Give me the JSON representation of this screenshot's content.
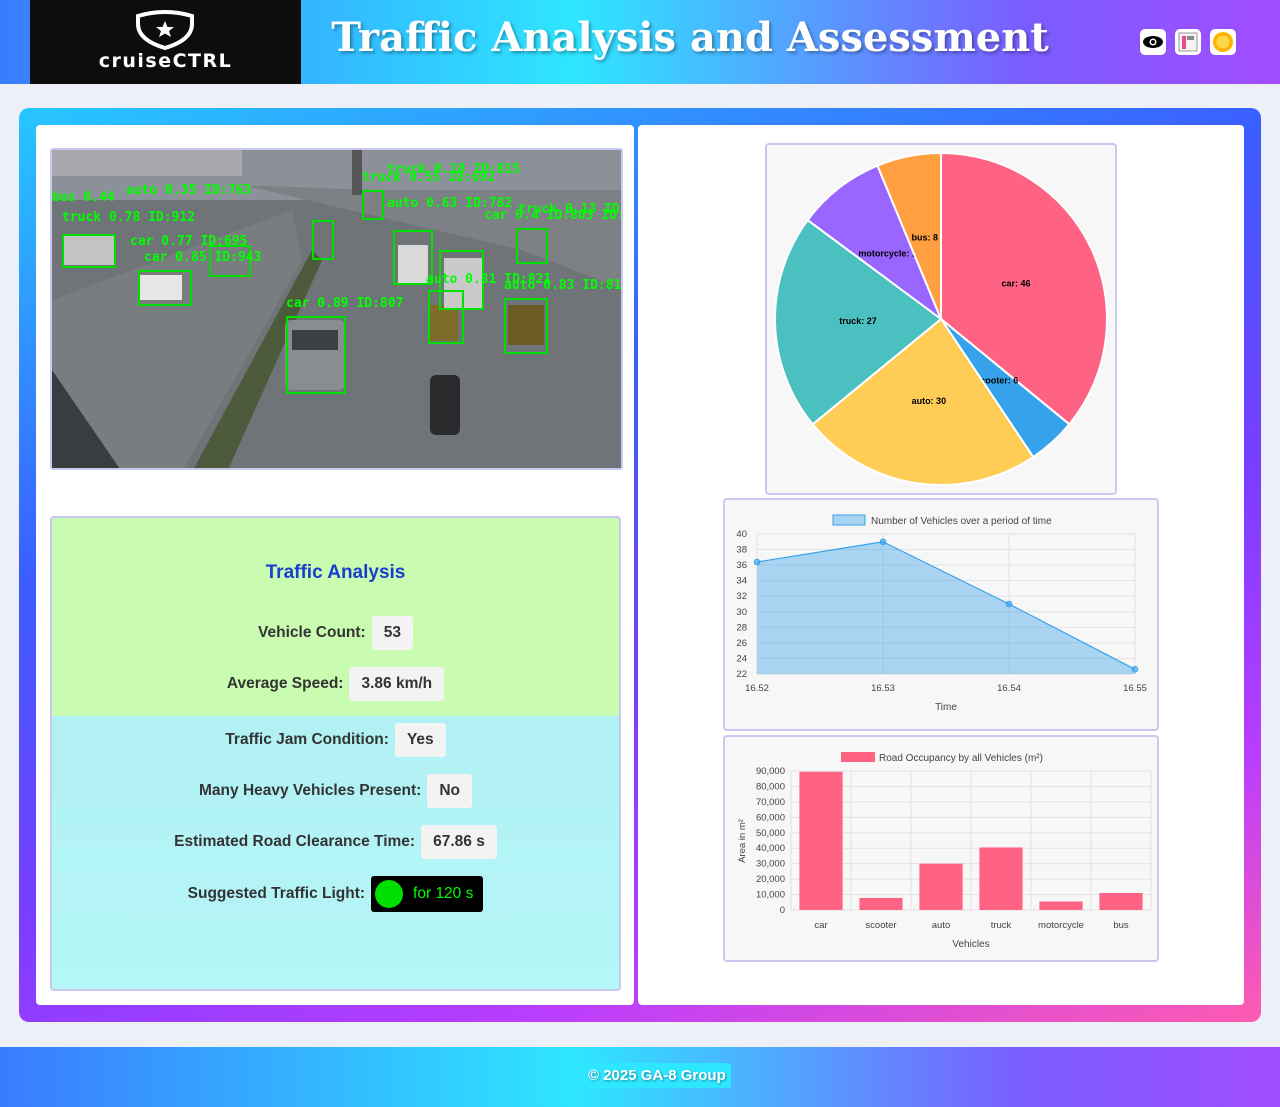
{
  "header": {
    "logo_text": "cruiseCTRL",
    "title": "Traffic Analysis and Assessment",
    "icons": [
      "eye-icon",
      "layout-icon",
      "sun-icon"
    ]
  },
  "video": {
    "detections": [
      {
        "label": "bus 0.44"
      },
      {
        "label": "auto 0.35 ID:763"
      },
      {
        "label": "truck 0.78 ID:912"
      },
      {
        "label": "car 0.77 ID:695"
      },
      {
        "label": "car 0.85 ID:943"
      },
      {
        "label": "truck 0.18 ID:815"
      },
      {
        "label": "truck 0.55 ID:692"
      },
      {
        "label": "auto 0.63 ID:782"
      },
      {
        "label": "car 0.4 ID:803 ID:2"
      },
      {
        "label": "truck 0.13 ID:1"
      },
      {
        "label": "auto 0.81 ID:821"
      },
      {
        "label": "auto 0.83 ID:815"
      },
      {
        "label": "car 0.89 ID:807"
      }
    ]
  },
  "analysis": {
    "title": "Traffic Analysis",
    "vehicle_count_label": "Vehicle Count:",
    "vehicle_count": "53",
    "avg_speed_label": "Average Speed:",
    "avg_speed": "3.86 km/h",
    "jam_label": "Traffic Jam Condition:",
    "jam": "Yes",
    "heavy_label": "Many Heavy Vehicles Present:",
    "heavy": "No",
    "clearance_label": "Estimated Road Clearance Time:",
    "clearance": "67.86 s",
    "light_label": "Suggested Traffic Light:",
    "light_text": "for 120 s",
    "light_color": "#00e000"
  },
  "charts": {
    "pie": {
      "type": "pie",
      "slices": [
        {
          "name": "car",
          "value": 46,
          "label": "car: 46",
          "color": "#ff6384"
        },
        {
          "name": "scooter",
          "value": 6,
          "label": "scooter: 6",
          "color": "#36a2eb"
        },
        {
          "name": "auto",
          "value": 30,
          "label": "auto: 30",
          "color": "#ffcd56"
        },
        {
          "name": "truck",
          "value": 27,
          "label": "truck: 27",
          "color": "#4bc0c0"
        },
        {
          "name": "motorcycle",
          "value": 11,
          "label": "motorcycle: 11",
          "color": "#9966ff"
        },
        {
          "name": "bus",
          "value": 8,
          "label": "bus: 8",
          "color": "#ff9f40"
        }
      ]
    },
    "line": {
      "type": "area",
      "legend": "Number of Vehicles over a period of time",
      "x": [
        "16.52",
        "16.53",
        "16.54",
        "16.55"
      ],
      "y": [
        36.4,
        39,
        31,
        22.6
      ],
      "ylim": [
        22,
        40
      ],
      "yticks": [
        "40",
        "38",
        "36",
        "34",
        "32",
        "30",
        "28",
        "26",
        "24",
        "22"
      ],
      "xlabel": "Time",
      "color": "#36a2eb"
    },
    "bar": {
      "type": "bar",
      "legend": "Road Occupancy by all Vehicles (m²)",
      "categories": [
        "car",
        "scooter",
        "auto",
        "truck",
        "motorcycle",
        "bus"
      ],
      "values": [
        89500,
        7800,
        30000,
        40500,
        5500,
        11000
      ],
      "ylim": [
        0,
        90000
      ],
      "yticks": [
        "90,000",
        "80,000",
        "70,000",
        "60,000",
        "50,000",
        "40,000",
        "30,000",
        "20,000",
        "10,000",
        "0"
      ],
      "xlabel": "Vehicles",
      "ylabel": "Area in m²",
      "color": "#ff6384"
    }
  },
  "footer": {
    "text": "© 2025 GA-8 Group"
  }
}
